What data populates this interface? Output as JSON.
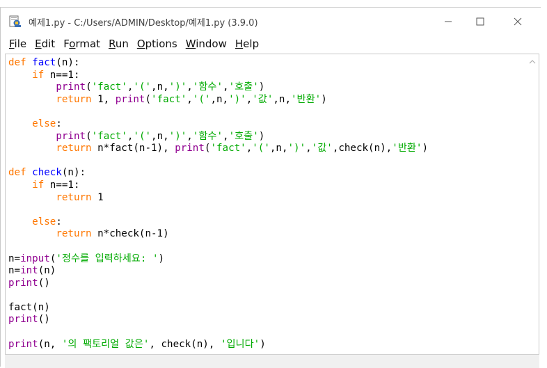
{
  "window": {
    "title": "예제1.py - C:/Users/ADMIN/Desktop/예제1.py (3.9.0)"
  },
  "menu": [
    {
      "key": "file",
      "accel": "F",
      "rest": "ile"
    },
    {
      "key": "edit",
      "accel": "E",
      "rest": "dit"
    },
    {
      "key": "format",
      "pre": "F",
      "accel": "o",
      "rest": "rmat"
    },
    {
      "key": "run",
      "accel": "R",
      "rest": "un"
    },
    {
      "key": "options",
      "accel": "O",
      "rest": "ptions"
    },
    {
      "key": "window",
      "accel": "W",
      "rest": "indow"
    },
    {
      "key": "help",
      "accel": "H",
      "rest": "elp"
    }
  ],
  "code_lines": [
    [
      [
        "def",
        "kw"
      ],
      [
        " "
      ],
      [
        "fact",
        "def"
      ],
      [
        "(n):"
      ]
    ],
    [
      [
        "    "
      ],
      [
        "if",
        "kw"
      ],
      [
        " n==1:"
      ]
    ],
    [
      [
        "        "
      ],
      [
        "print",
        "bi"
      ],
      [
        "("
      ],
      [
        "'fact'",
        "str"
      ],
      [
        ","
      ],
      [
        "'('",
        "str"
      ],
      [
        ",n,"
      ],
      [
        "')'",
        "str"
      ],
      [
        ","
      ],
      [
        "'함수'",
        "str"
      ],
      [
        ","
      ],
      [
        "'호출'",
        "str"
      ],
      [
        ")"
      ]
    ],
    [
      [
        "        "
      ],
      [
        "return",
        "kw"
      ],
      [
        " 1, "
      ],
      [
        "print",
        "bi"
      ],
      [
        "("
      ],
      [
        "'fact'",
        "str"
      ],
      [
        ","
      ],
      [
        "'('",
        "str"
      ],
      [
        ",n,"
      ],
      [
        "')'",
        "str"
      ],
      [
        ","
      ],
      [
        "'값'",
        "str"
      ],
      [
        ",n,"
      ],
      [
        "'반환'",
        "str"
      ],
      [
        ")"
      ]
    ],
    [
      [
        ""
      ]
    ],
    [
      [
        "    "
      ],
      [
        "else",
        "kw"
      ],
      [
        ":"
      ]
    ],
    [
      [
        "        "
      ],
      [
        "print",
        "bi"
      ],
      [
        "("
      ],
      [
        "'fact'",
        "str"
      ],
      [
        ","
      ],
      [
        "'('",
        "str"
      ],
      [
        ",n,"
      ],
      [
        "')'",
        "str"
      ],
      [
        ","
      ],
      [
        "'함수'",
        "str"
      ],
      [
        ","
      ],
      [
        "'호출'",
        "str"
      ],
      [
        ")"
      ]
    ],
    [
      [
        "        "
      ],
      [
        "return",
        "kw"
      ],
      [
        " n*fact(n-1), "
      ],
      [
        "print",
        "bi"
      ],
      [
        "("
      ],
      [
        "'fact'",
        "str"
      ],
      [
        ","
      ],
      [
        "'('",
        "str"
      ],
      [
        ",n,"
      ],
      [
        "')'",
        "str"
      ],
      [
        ","
      ],
      [
        "'값'",
        "str"
      ],
      [
        ",check(n),"
      ],
      [
        "'반환'",
        "str"
      ],
      [
        ")"
      ]
    ],
    [
      [
        ""
      ]
    ],
    [
      [
        "def",
        "kw"
      ],
      [
        " "
      ],
      [
        "check",
        "def"
      ],
      [
        "(n):"
      ]
    ],
    [
      [
        "    "
      ],
      [
        "if",
        "kw"
      ],
      [
        " n==1:"
      ]
    ],
    [
      [
        "        "
      ],
      [
        "return",
        "kw"
      ],
      [
        " 1"
      ]
    ],
    [
      [
        ""
      ]
    ],
    [
      [
        "    "
      ],
      [
        "else",
        "kw"
      ],
      [
        ":"
      ]
    ],
    [
      [
        "        "
      ],
      [
        "return",
        "kw"
      ],
      [
        " n*check(n-1)"
      ]
    ],
    [
      [
        ""
      ]
    ],
    [
      [
        "n="
      ],
      [
        "input",
        "bi"
      ],
      [
        "("
      ],
      [
        "'정수를 입력하세요: '",
        "str"
      ],
      [
        ")"
      ]
    ],
    [
      [
        "n="
      ],
      [
        "int",
        "bi"
      ],
      [
        "(n)"
      ]
    ],
    [
      [
        "print",
        "bi"
      ],
      [
        "()"
      ]
    ],
    [
      [
        ""
      ]
    ],
    [
      [
        "fact(n)"
      ]
    ],
    [
      [
        "print",
        "bi"
      ],
      [
        "()"
      ]
    ],
    [
      [
        ""
      ]
    ],
    [
      [
        "print",
        "bi"
      ],
      [
        "(n, "
      ],
      [
        "'의 팩토리얼 값은'",
        "str"
      ],
      [
        ", check(n), "
      ],
      [
        "'입니다'",
        "str"
      ],
      [
        ")"
      ]
    ]
  ]
}
